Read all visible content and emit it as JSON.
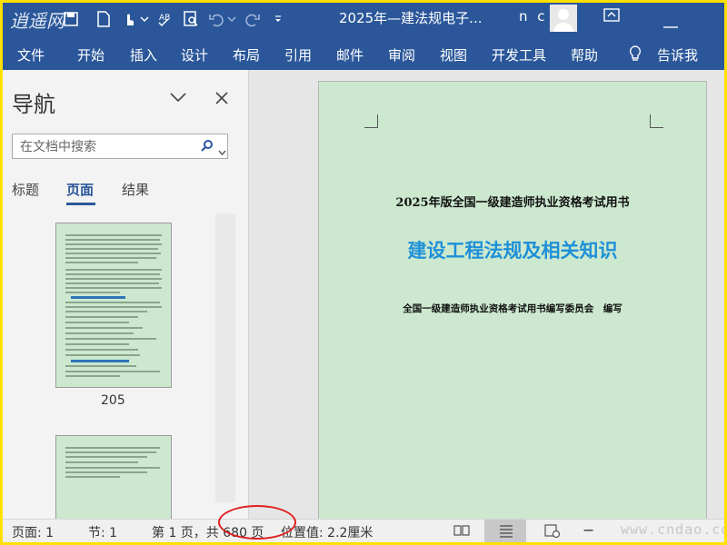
{
  "window": {
    "title": "2025年—建法规电子...",
    "user_initials": "n c",
    "quick_access_icons": [
      "save-icon",
      "touch-mode-icon",
      "spelling-check-icon",
      "print-preview-icon",
      "undo-icon",
      "redo-icon",
      "customize-icon"
    ]
  },
  "watermark": {
    "logo_text": "逍遥网",
    "site_text": "www.cndao.com"
  },
  "ribbon": {
    "tabs": [
      "文件",
      "开始",
      "插入",
      "设计",
      "布局",
      "引用",
      "邮件",
      "审阅",
      "视图",
      "开发工具",
      "帮助"
    ],
    "tell_me": "告诉我"
  },
  "nav": {
    "title": "导航",
    "search_placeholder": "在文档中搜索",
    "tabs": [
      "标题",
      "页面",
      "结果"
    ],
    "active_tab": "页面",
    "thumbnail_page_number": "205"
  },
  "document": {
    "line1": "2025年版全国一级建造师执业资格考试用书",
    "title": "建设工程法规及相关知识",
    "line3": "全国一级建造师执业资格考试用书编写委员会　编写"
  },
  "status": {
    "page": "页面: 1",
    "section": "节: 1",
    "page_count": "第 1 页，共 680 页",
    "position": "位置值: 2.2厘米"
  },
  "colors": {
    "ribbon": "#2b579a",
    "page_background": "#cce8cf",
    "heading_blue": "#1e90d8",
    "highlight_oval": "#e02020"
  }
}
